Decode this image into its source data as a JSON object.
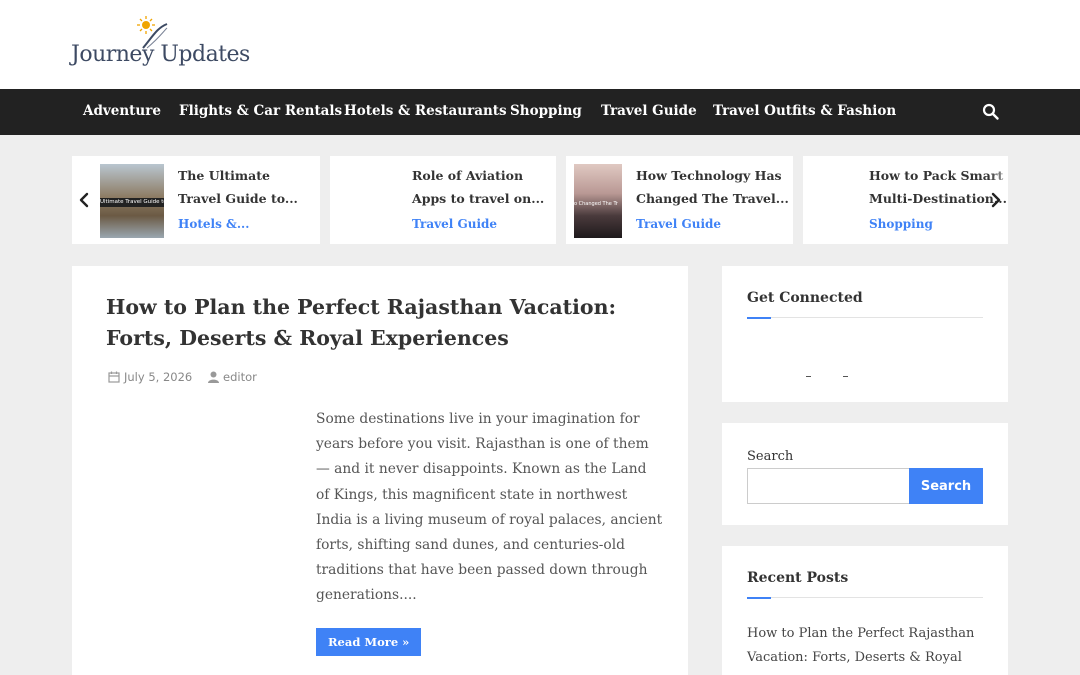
{
  "site": {
    "logo_text": "Journey Updates"
  },
  "nav": {
    "items": [
      {
        "label": "Adventure"
      },
      {
        "label": "Flights & Car Rentals"
      },
      {
        "label": "Hotels & Restaurants"
      },
      {
        "label": "Shopping"
      },
      {
        "label": "Travel Guide"
      },
      {
        "label": "Travel Outfits & Fashion"
      }
    ],
    "search_icon": "search-icon"
  },
  "slider": {
    "cards": [
      {
        "title_line1": "The Ultimate",
        "title_line2": "Travel Guide to...",
        "category": "Hotels &...",
        "thumb_text": "Ultimate Travel Guide to"
      },
      {
        "title_line1": "Role of Aviation",
        "title_line2": "Apps to travel on...",
        "category": "Travel Guide"
      },
      {
        "title_line1": "How Technology Has",
        "title_line2": "Changed The Travel...",
        "category": "Travel Guide",
        "thumb_text": "o Changed The Tr"
      },
      {
        "title_line1": "How to Pack Smart for",
        "title_line2": "Multi-Destination...",
        "category": "Shopping"
      }
    ],
    "prev_icon": "chevron-left-icon",
    "next_icon": "chevron-right-icon"
  },
  "article": {
    "title": "How to Plan the Perfect Rajasthan Vacation: Forts, Deserts & Royal Experiences",
    "date": "July 5, 2026",
    "author": "editor",
    "excerpt": "Some destinations live in your imagination for years before you visit. Rajasthan is one of them — and it never disappoints. Known as the Land of Kings, this magnificent state in northwest India is a living museum of royal palaces, ancient forts, shifting sand dunes, and centuries-old traditions that have been passed down through generations....",
    "read_more": "Read More »"
  },
  "sidebar": {
    "connected_title": "Get Connected",
    "search_label": "Search",
    "search_value": "",
    "search_button": "Search",
    "recent_title": "Recent Posts",
    "recent_posts": [
      "How to Plan the Perfect Rajasthan Vacation: Forts, Deserts & Royal"
    ]
  },
  "colors": {
    "accent": "#3f82f6",
    "nav_bg": "#222222",
    "page_bg": "#eeeeee"
  }
}
